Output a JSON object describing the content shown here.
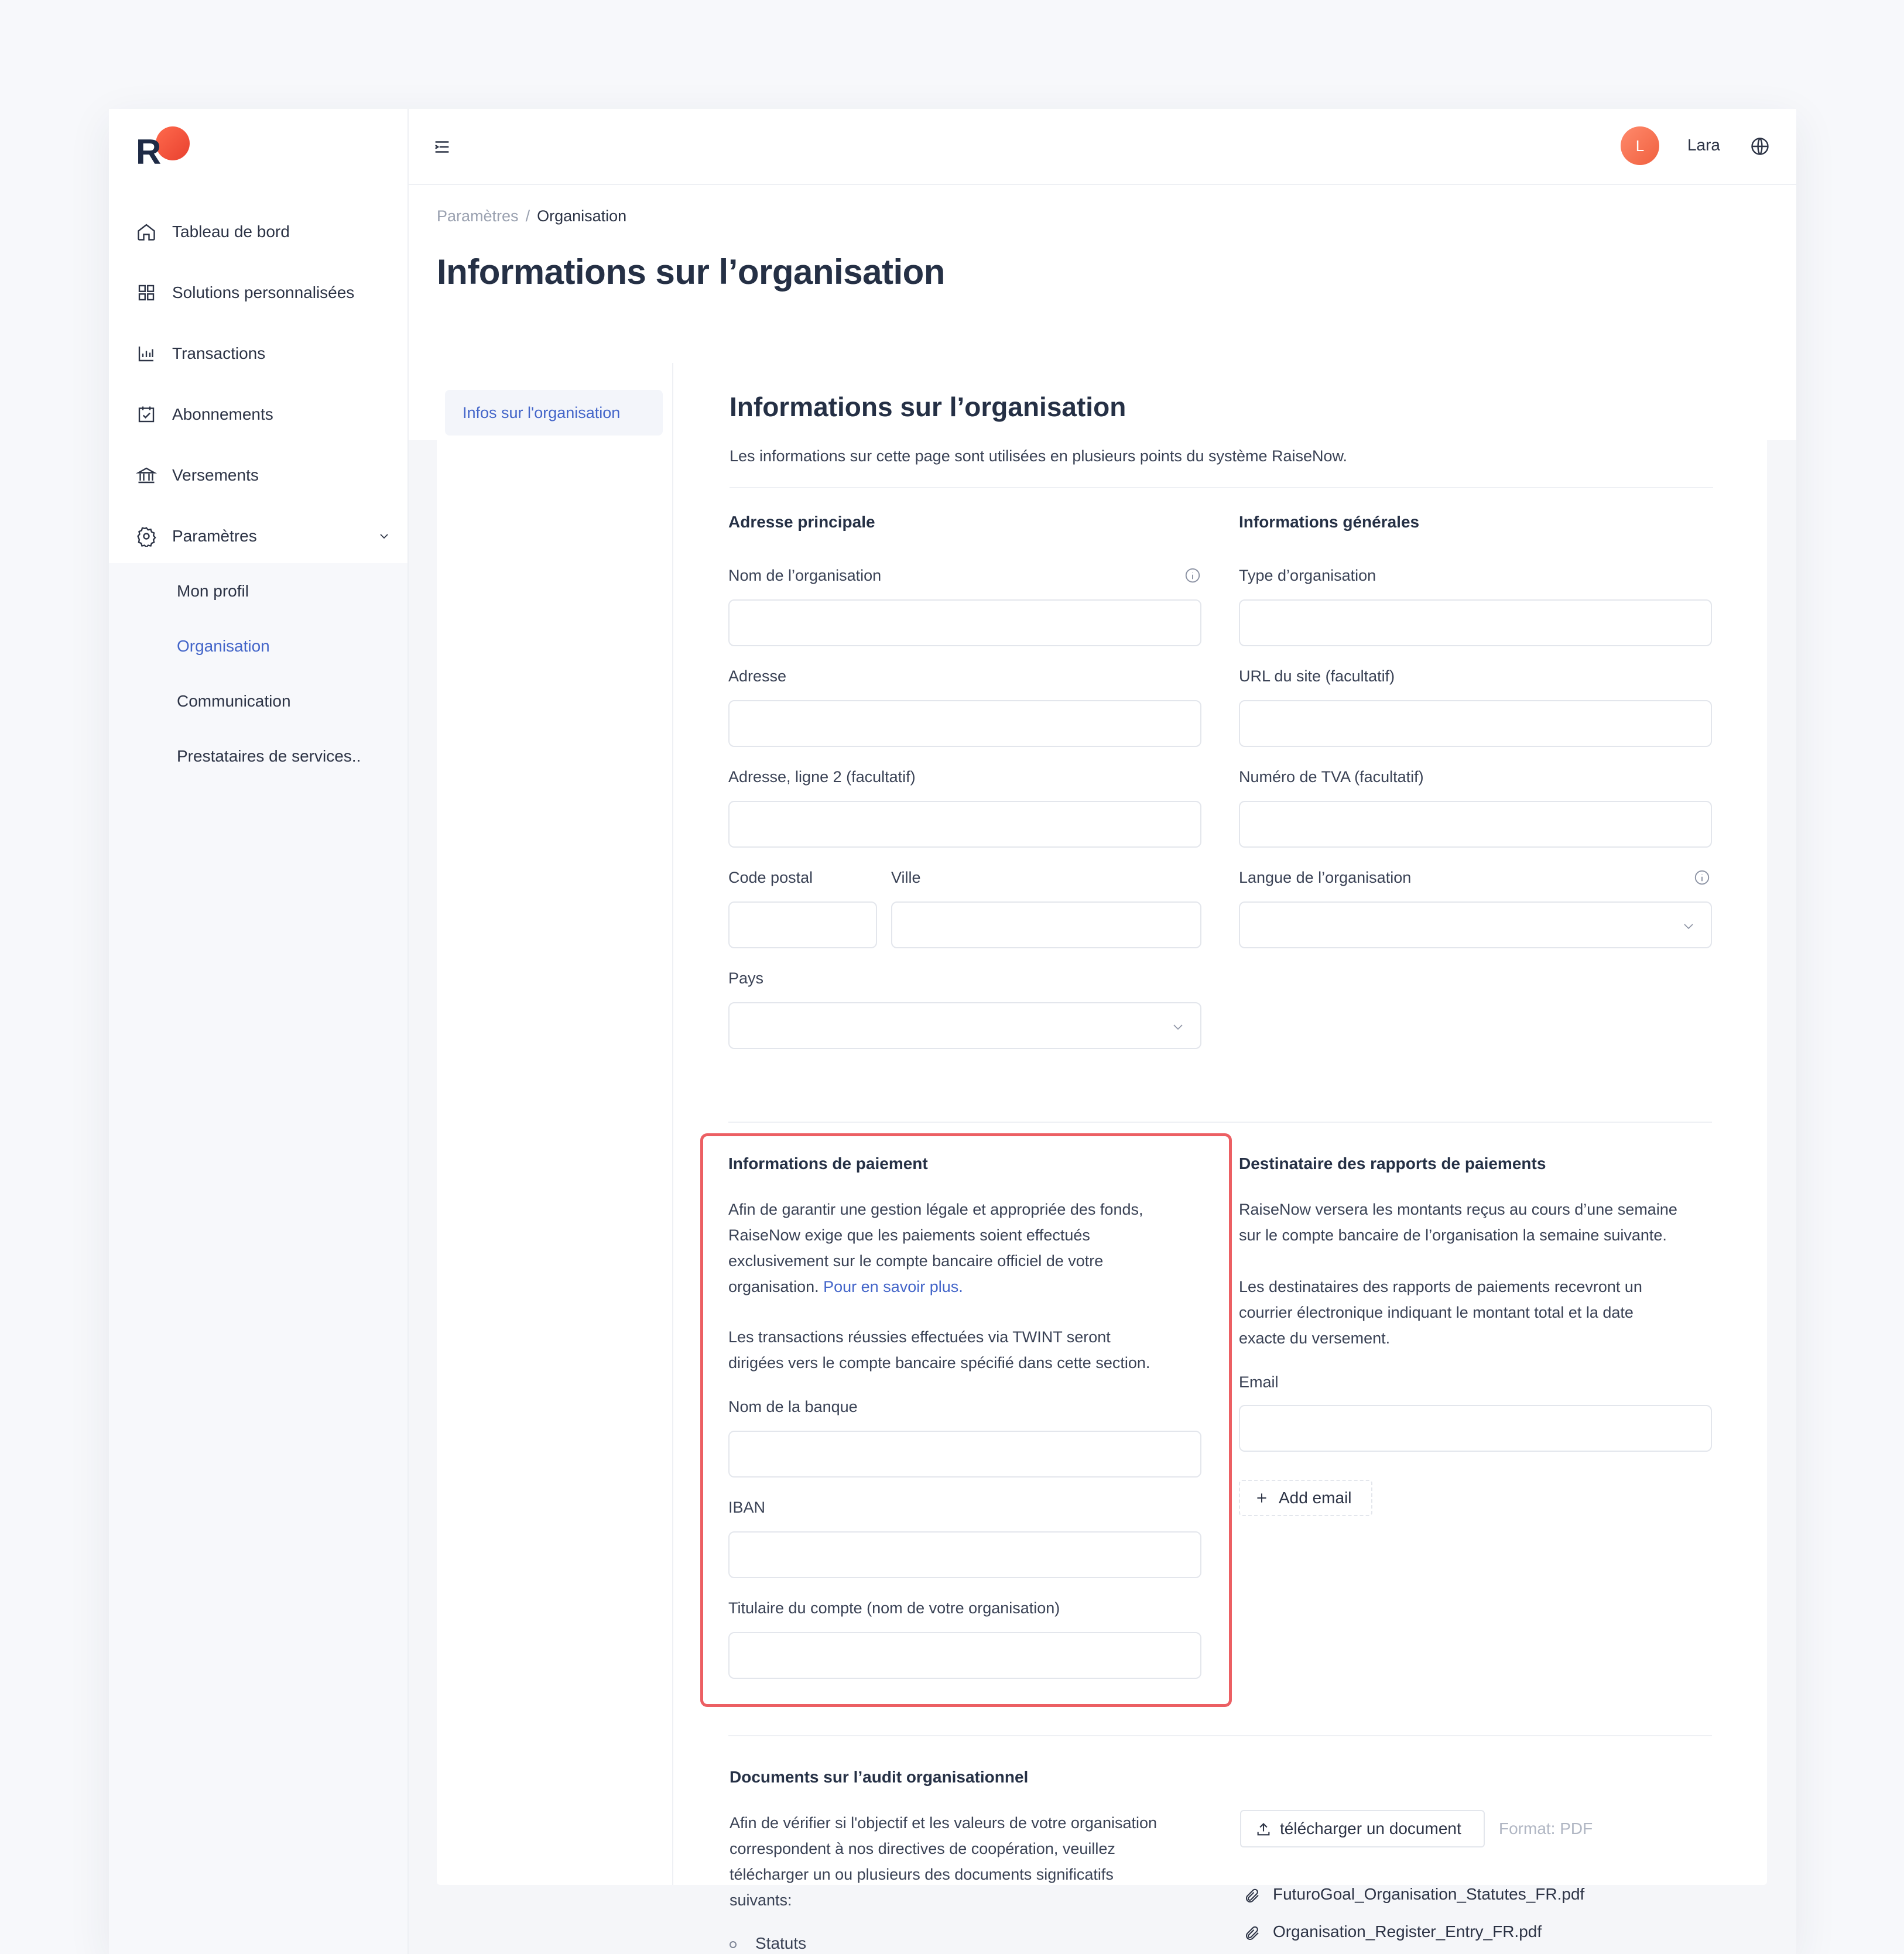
{
  "sidebar": {
    "logo_letter": "R",
    "items": [
      {
        "label": "Tableau de bord",
        "icon": "home-icon"
      },
      {
        "label": "Solutions personnalisées",
        "icon": "grid-icon"
      },
      {
        "label": "Transactions",
        "icon": "bar-chart-icon"
      },
      {
        "label": "Abonnements",
        "icon": "calendar-check-icon"
      },
      {
        "label": "Versements",
        "icon": "bank-icon"
      },
      {
        "label": "Paramètres",
        "icon": "gear-icon"
      }
    ],
    "submenu": [
      {
        "label": "Mon profil"
      },
      {
        "label": "Organisation"
      },
      {
        "label": "Communication"
      },
      {
        "label": "Prestataires de services.."
      }
    ]
  },
  "topbar": {
    "avatar_initial": "L",
    "user_name": "Lara"
  },
  "header": {
    "breadcrumb": [
      "Paramètres",
      "/",
      "Organisation"
    ],
    "title": "Informations sur l’organisation"
  },
  "tabs": {
    "active": "Infos sur l'organisation"
  },
  "content": {
    "title": "Informations sur l’organisation",
    "description": "Les informations sur cette page sont utilisées en plusieurs points du système RaiseNow.",
    "address": {
      "title": "Adresse principale",
      "org_name_label": "Nom de l’organisation",
      "address_label": "Adresse",
      "address2_label": "Adresse, ligne 2 (facultatif)",
      "postal_label": "Code postal",
      "city_label": "Ville",
      "country_label": "Pays"
    },
    "general": {
      "title": "Informations générales",
      "type_label": "Type d’organisation",
      "url_label": "URL du site (facultatif)",
      "vat_label": "Numéro de TVA (facultatif)",
      "language_label": "Langue de l’organisation"
    },
    "payment": {
      "title": "Informations de paiement",
      "para1_line1": "Afin de garantir une gestion légale et appropriée des fonds,",
      "para1_line2": "RaiseNow exige que les paiements soient effectués",
      "para1_line3": "exclusivement sur le compte bancaire officiel de votre",
      "para1_line4": "organisation.",
      "para1_link": "Pour en savoir plus.",
      "para2_line1": "Les transactions réussies effectuées via TWINT seront",
      "para2_line2": "dirigées vers le compte bancaire spécifié dans cette section.",
      "bank_label": "Nom de la banque",
      "iban_label": "IBAN",
      "holder_label": "Titulaire du compte (nom de votre organisation)"
    },
    "reports": {
      "title": "Destinataire des rapports de paiements",
      "para1_line1": "RaiseNow versera les montants reçus au cours d’une semaine",
      "para1_line2": "sur le compte bancaire de l’organisation la semaine suivante.",
      "para2_line1": "Les destinataires des rapports de paiements recevront un",
      "para2_line2": "courrier électronique indiquant le montant total et la date",
      "para2_line3": "exacte du versement.",
      "email_label": "Email",
      "add_email": "Add email"
    },
    "audit": {
      "title": "Documents sur l’audit organisationnel",
      "para_line1": "Afin de vérifier si l'objectif et les valeurs de votre organisation",
      "para_line2": "correspondent à nos directives de coopération, veuillez",
      "para_line3": "télécharger un ou plusieurs des documents significatifs",
      "para_line4": "suivants:",
      "bullet1": "Statuts",
      "upload_button": "télécharger un document",
      "format": "Format: PDF",
      "files": [
        "FuturoGoal_Organisation_Statutes_FR.pdf",
        "Organisation_Register_Entry_FR.pdf"
      ]
    }
  },
  "colors": {
    "accent": "#4365c9",
    "highlight": "#ec5f63",
    "brand": "#e8412f"
  }
}
